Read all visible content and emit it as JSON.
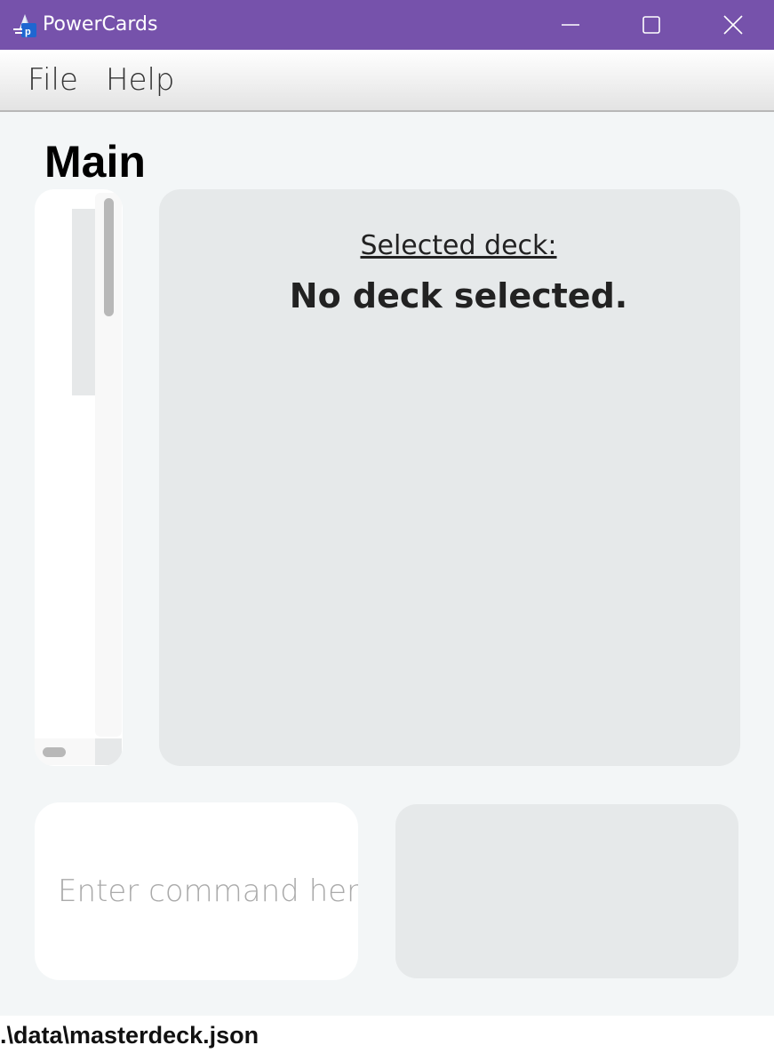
{
  "window": {
    "title": "PowerCards",
    "app_icon": "powercards-logo-icon",
    "controls": [
      "minimize-icon",
      "maximize-icon",
      "close-icon"
    ]
  },
  "menu": {
    "file": "File",
    "help": "Help"
  },
  "main": {
    "title": "Main",
    "selected_label": "Selected deck:",
    "selected_value": "No deck selected."
  },
  "command": {
    "placeholder": "Enter command here.",
    "value": ""
  },
  "status": {
    "path": ".\\data\\masterdeck.json"
  },
  "colors": {
    "titlebar": "#7652ab",
    "panel": "#e6e9ea",
    "background": "#f3f6f7"
  }
}
